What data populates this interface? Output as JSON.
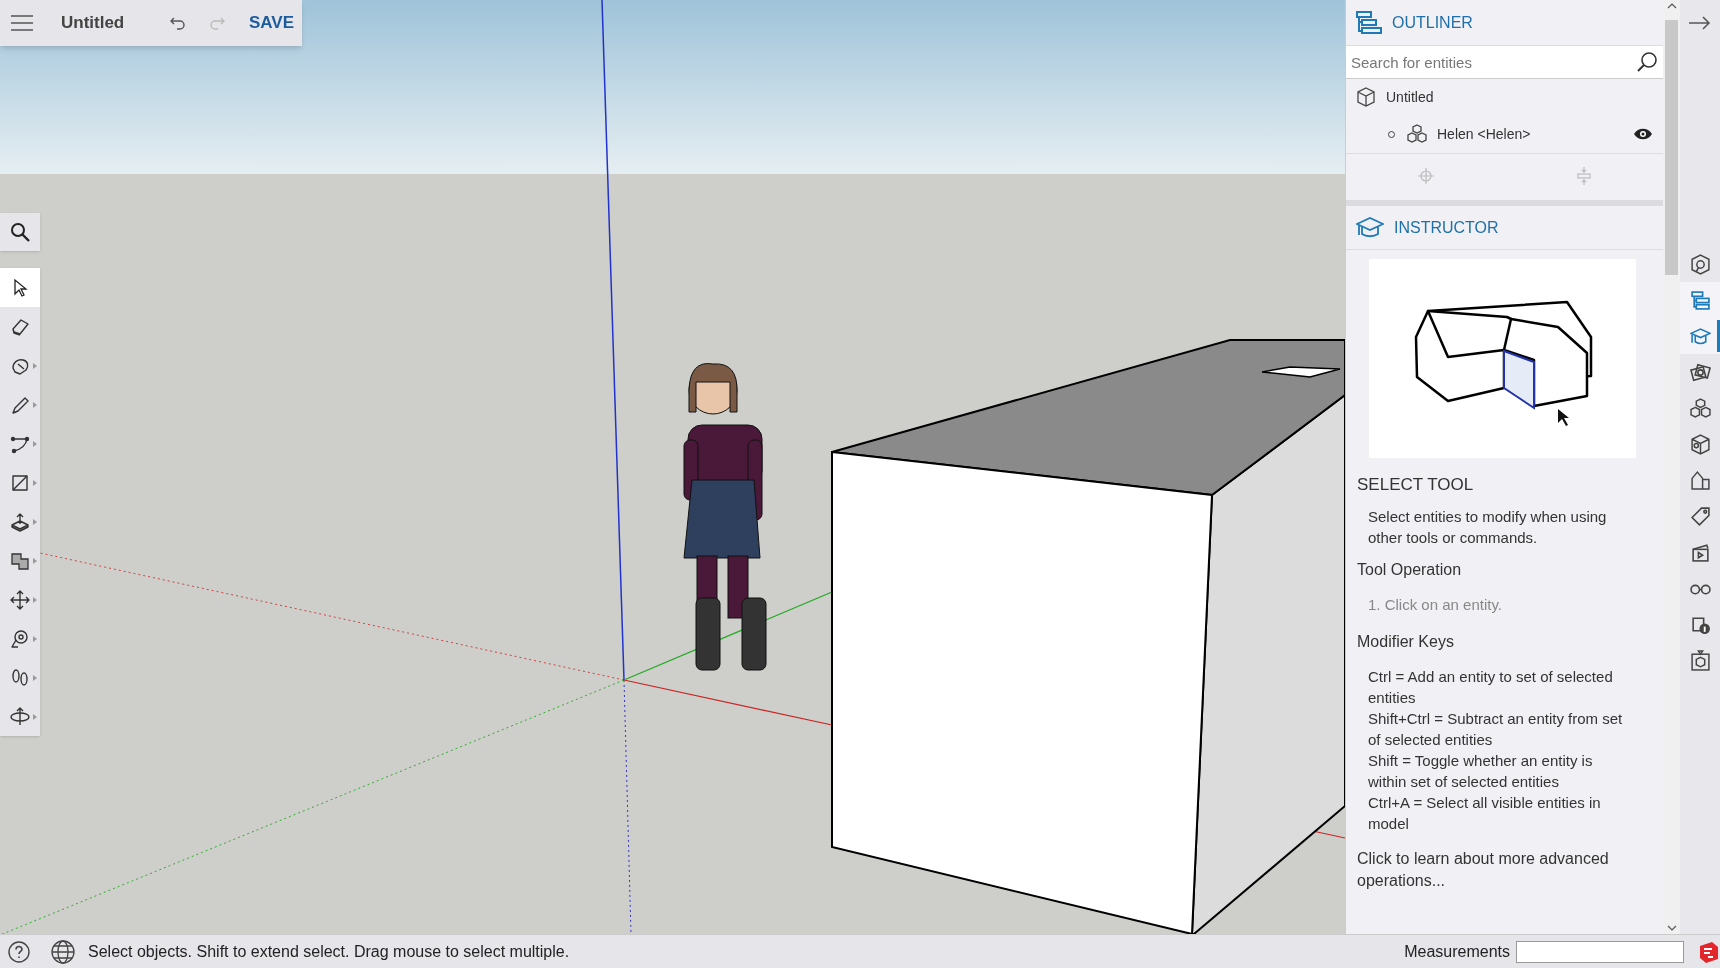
{
  "toolbar": {
    "title": "Untitled",
    "save_label": "SAVE",
    "undo_enabled": true,
    "redo_enabled": false
  },
  "search_tool": {
    "kind": "search"
  },
  "tools": [
    {
      "kind": "select",
      "selected": true,
      "flyout": false
    },
    {
      "kind": "eraser",
      "selected": false,
      "flyout": false
    },
    {
      "kind": "paint",
      "selected": false,
      "flyout": true
    },
    {
      "kind": "pencil",
      "selected": false,
      "flyout": true
    },
    {
      "kind": "arc",
      "selected": false,
      "flyout": true
    },
    {
      "kind": "rectangle",
      "selected": false,
      "flyout": true
    },
    {
      "kind": "pushpull",
      "selected": false,
      "flyout": true
    },
    {
      "kind": "offset",
      "selected": false,
      "flyout": true
    },
    {
      "kind": "move",
      "selected": false,
      "flyout": true
    },
    {
      "kind": "tape",
      "selected": false,
      "flyout": true
    },
    {
      "kind": "walk",
      "selected": false,
      "flyout": true
    },
    {
      "kind": "orbit",
      "selected": false,
      "flyout": true
    }
  ],
  "outliner": {
    "title": "OUTLINER",
    "search": {
      "placeholder": "Search for entities"
    },
    "tree": [
      {
        "label": "Untitled",
        "kind": "model",
        "children": [
          {
            "label": "Helen <Helen>",
            "kind": "component",
            "visible": true
          }
        ]
      }
    ]
  },
  "instructor": {
    "title": "INSTRUCTOR",
    "tool_name": "SELECT TOOL",
    "description": "Select entities to modify when using other tools or commands.",
    "operation_heading": "Tool Operation",
    "steps": [
      "1. Click on an entity."
    ],
    "modifier_heading": "Modifier Keys",
    "modifiers": [
      "Ctrl = Add an entity to set of selected entities",
      "Shift+Ctrl = Subtract an entity from set of selected entities",
      "Shift = Toggle whether an entity is within set of selected entities",
      "Ctrl+A = Select all visible entities in model"
    ],
    "link": "Click to learn about more advanced operations..."
  },
  "side_panels": [
    {
      "kind": "entity-info",
      "open": false,
      "selected": false
    },
    {
      "kind": "outliner",
      "open": true,
      "selected": false
    },
    {
      "kind": "instructor",
      "open": true,
      "selected": true
    },
    {
      "kind": "materials",
      "open": false,
      "selected": false
    },
    {
      "kind": "components",
      "open": false,
      "selected": false
    },
    {
      "kind": "styles",
      "open": false,
      "selected": false
    },
    {
      "kind": "warehouse",
      "open": false,
      "selected": false
    },
    {
      "kind": "tags",
      "open": false,
      "selected": false
    },
    {
      "kind": "scenes",
      "open": false,
      "selected": false
    },
    {
      "kind": "display",
      "open": false,
      "selected": false
    },
    {
      "kind": "model-info",
      "open": false,
      "selected": false
    },
    {
      "kind": "solid",
      "open": false,
      "selected": false
    }
  ],
  "status_bar": {
    "text": "Select objects. Shift to extend select. Drag mouse to select multiple.",
    "measurements_label": "Measurements"
  }
}
